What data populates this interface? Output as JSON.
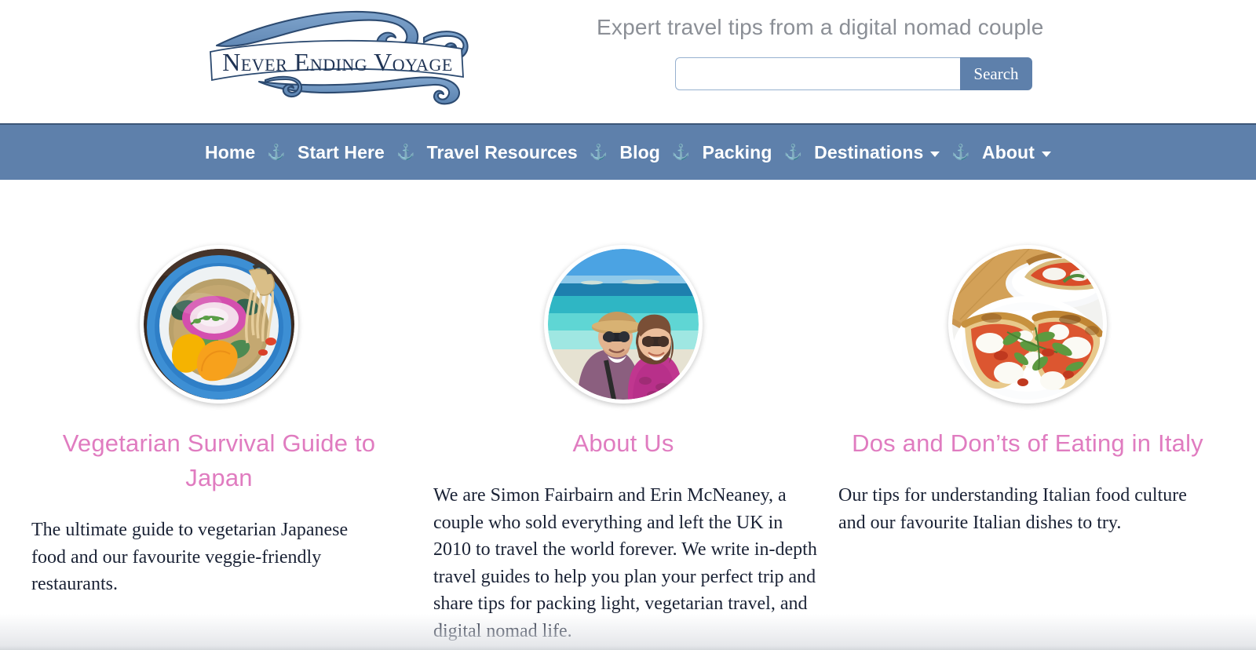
{
  "site": {
    "logo_text": "Never Ending Voyage",
    "logo_icon": "wave-swirl-logo",
    "tagline": "Expert travel tips from a digital nomad couple"
  },
  "search": {
    "value": "",
    "placeholder": "",
    "button_label": "Search",
    "icon": "search-icon"
  },
  "nav": {
    "separator_icon": "anchor-icon",
    "separator_glyph": "⚓",
    "items": [
      {
        "label": "Home",
        "has_dropdown": false
      },
      {
        "label": "Start Here",
        "has_dropdown": false
      },
      {
        "label": "Travel Resources",
        "has_dropdown": false
      },
      {
        "label": "Blog",
        "has_dropdown": false
      },
      {
        "label": "Packing",
        "has_dropdown": false
      },
      {
        "label": "Destinations",
        "has_dropdown": true
      },
      {
        "label": "About",
        "has_dropdown": true
      }
    ]
  },
  "cards": [
    {
      "image_name": "japanese-ramen-bowl-photo",
      "title": "Vegetarian Survival Guide to Japan",
      "body": "The ultimate guide to vegetarian Japanese food and our favourite veggie-friendly restaurants."
    },
    {
      "image_name": "couple-on-beach-photo",
      "title": "About Us",
      "body": "We are Simon Fairbairn and Erin McNeaney, a couple who sold everything and left the UK in 2010 to travel the world forever. We write in-depth travel guides to help you plan your perfect trip and share tips for packing light, vegetarian travel, and digital nomad life."
    },
    {
      "image_name": "italian-pizza-plate-photo",
      "title": "Dos and Don’ts of Eating in Italy",
      "body": "Our tips for understanding Italian food culture and our favourite Italian dishes to try."
    }
  ],
  "colors": {
    "nav_blue": "#5e80ab",
    "nav_border": "#3c5678",
    "title_pink": "#e07cc0",
    "body_text": "#1a2235",
    "tagline_grey": "#8b8f96"
  }
}
